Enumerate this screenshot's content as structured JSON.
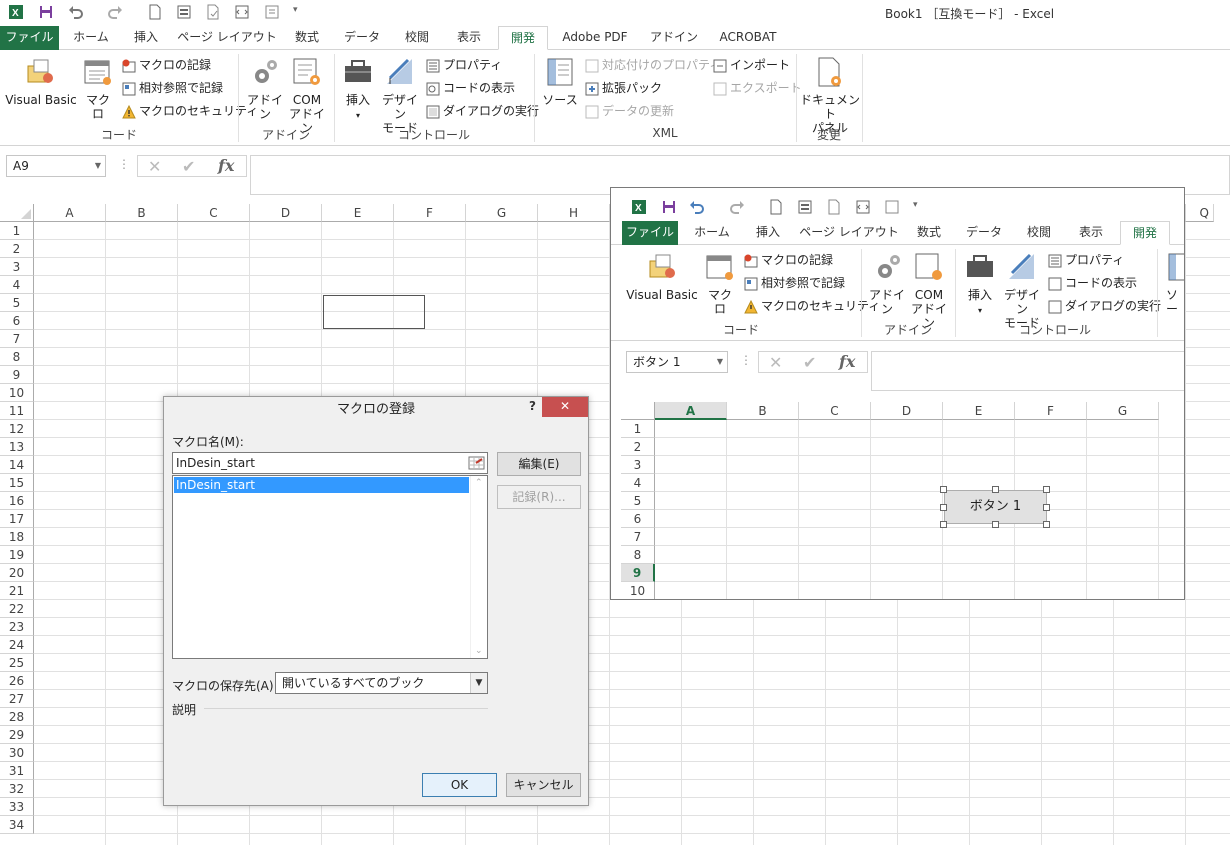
{
  "app": {
    "title": "Book1 ［互換モード］ - Excel"
  },
  "tabs": [
    "ファイル",
    "ホーム",
    "挿入",
    "ページ レイアウト",
    "数式",
    "データ",
    "校閲",
    "表示",
    "開発",
    "Adobe PDF",
    "アドイン",
    "ACROBAT"
  ],
  "ribbon": {
    "code": {
      "label": "コード",
      "visual_basic": "Visual Basic",
      "macro": "マクロ",
      "record_macro": "マクロの記録",
      "relative_ref": "相対参照で記録",
      "macro_security": "マクロのセキュリティ"
    },
    "addins": {
      "label": "アドイン",
      "addin": "アドイン",
      "com_addin_1": "COM",
      "com_addin_2": "アドイン"
    },
    "controls": {
      "label": "コントロール",
      "insert": "挿入",
      "design_mode_1": "デザイン",
      "design_mode_2": "モード",
      "properties": "プロパティ",
      "view_code": "コードの表示",
      "run_dialog": "ダイアログの実行"
    },
    "xml": {
      "label": "XML",
      "source": "ソース",
      "map_properties": "対応付けのプロパティ",
      "expansion_packs": "拡張パック",
      "refresh_data": "データの更新",
      "import": "インポート",
      "export": "エクスポート"
    },
    "modify": {
      "label": "変更",
      "doc_panel_1": "ドキュメント",
      "doc_panel_2": "パネル"
    }
  },
  "formula_bar": {
    "name_box": "A9",
    "cancel": "✕",
    "enter": "✔",
    "fx": "fx"
  },
  "grid": {
    "columns": [
      "A",
      "B",
      "C",
      "D",
      "E",
      "F",
      "G",
      "H"
    ],
    "far_column": "Q",
    "rows": [
      "1",
      "2",
      "3",
      "4",
      "5",
      "6",
      "7",
      "8",
      "9",
      "10",
      "11",
      "12",
      "13",
      "14",
      "15",
      "16",
      "17",
      "18",
      "19",
      "20",
      "21",
      "22",
      "23",
      "24",
      "25",
      "26",
      "27",
      "28",
      "29",
      "30",
      "31",
      "32",
      "33",
      "34"
    ]
  },
  "dialog": {
    "title": "マクロの登録",
    "help": "?",
    "close": "✕",
    "macro_name_label": "マクロ名(M):",
    "macro_name_value": "InDesin_start",
    "macro_list": [
      "InDesin_start"
    ],
    "edit_button": "編集(E)",
    "record_button": "記録(R)...",
    "store_label": "マクロの保存先(A):",
    "store_value": "開いているすべてのブック",
    "description_label": "説明",
    "ok_button": "OK",
    "cancel_button": "キャンセル"
  },
  "inset": {
    "tabs": [
      "ファイル",
      "ホーム",
      "挿入",
      "ページ レイアウト",
      "数式",
      "データ",
      "校閲",
      "表示",
      "開発"
    ],
    "code": {
      "label": "コード",
      "visual_basic": "Visual Basic",
      "macro": "マクロ",
      "record_macro": "マクロの記録",
      "relative_ref": "相対参照で記録",
      "macro_security": "マクロのセキュリティ"
    },
    "addins": {
      "label": "アドイン",
      "addin": "アドイン",
      "com_addin_1": "COM",
      "com_addin_2": "アドイン"
    },
    "controls": {
      "label": "コントロール",
      "insert": "挿入",
      "design_mode_1": "デザイン",
      "design_mode_2": "モード",
      "properties": "プロパティ",
      "view_code": "コードの表示",
      "run_dialog": "ダイアログの実行"
    },
    "source_partial": "ソー",
    "name_box": "ボタン 1",
    "columns": [
      "A",
      "B",
      "C",
      "D",
      "E",
      "F",
      "G"
    ],
    "rows": [
      "1",
      "2",
      "3",
      "4",
      "5",
      "6",
      "7",
      "8",
      "9",
      "10"
    ],
    "form_button": "ボタン 1"
  },
  "colors": {
    "excel_green": "#217346",
    "selection_blue": "#3399ff",
    "close_red": "#c75050"
  }
}
